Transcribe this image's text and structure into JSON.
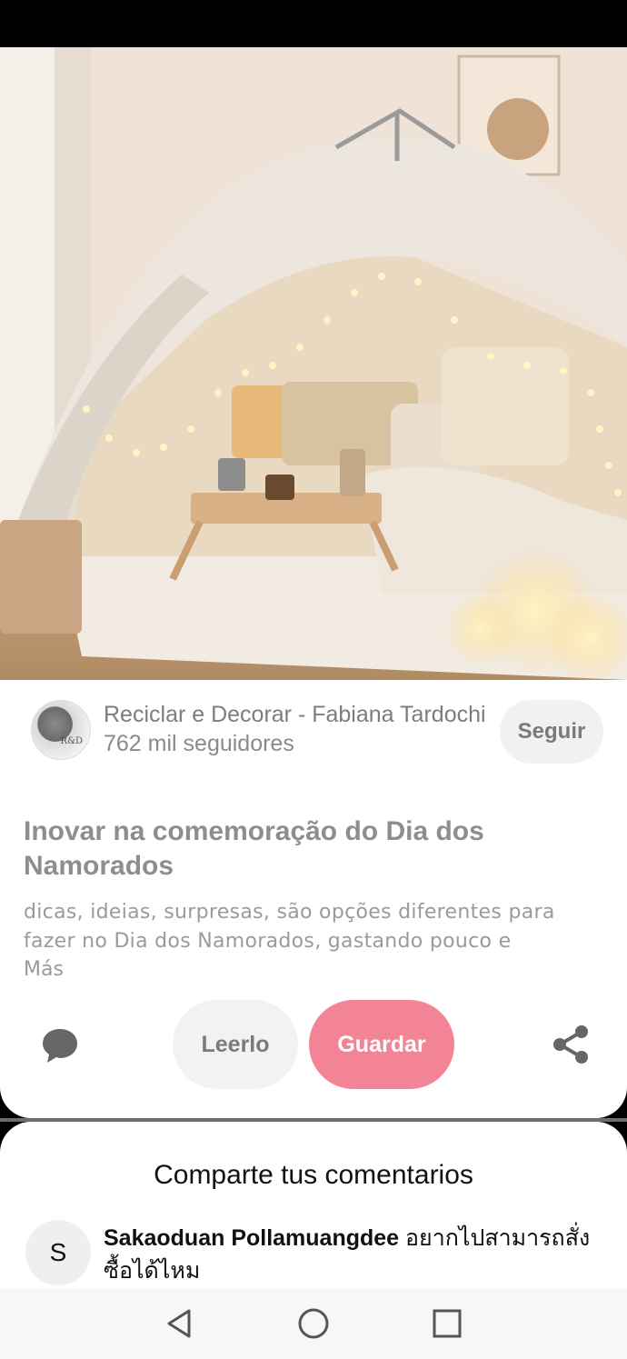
{
  "pin": {
    "image_alt": "Tenda decorada com luzes e almofadas",
    "author": {
      "name": "Reciclar e Decorar - Fabiana Tardochi",
      "followers": "762 mil seguidores",
      "avatar_text": "R&D",
      "follow_label": "Seguir"
    },
    "title": "Inovar na comemoração do Dia dos Namorados",
    "description": "dicas, ideias, surpresas, são opções diferentes para fazer no Dia dos Namorados, gastando pouco e",
    "more_label": "Más",
    "actions": {
      "read_label": "Leerlo",
      "save_label": "Guardar"
    }
  },
  "comments": {
    "title": "Comparte tus comentarios",
    "items": [
      {
        "avatar_letter": "S",
        "user": "Sakaoduan Pollamuangdee",
        "text": " อยากไปสามารถสั่งซื้อได้ไหม"
      }
    ]
  },
  "colors": {
    "save_button": "#f28495",
    "follow_button": "#f1f1f1"
  }
}
